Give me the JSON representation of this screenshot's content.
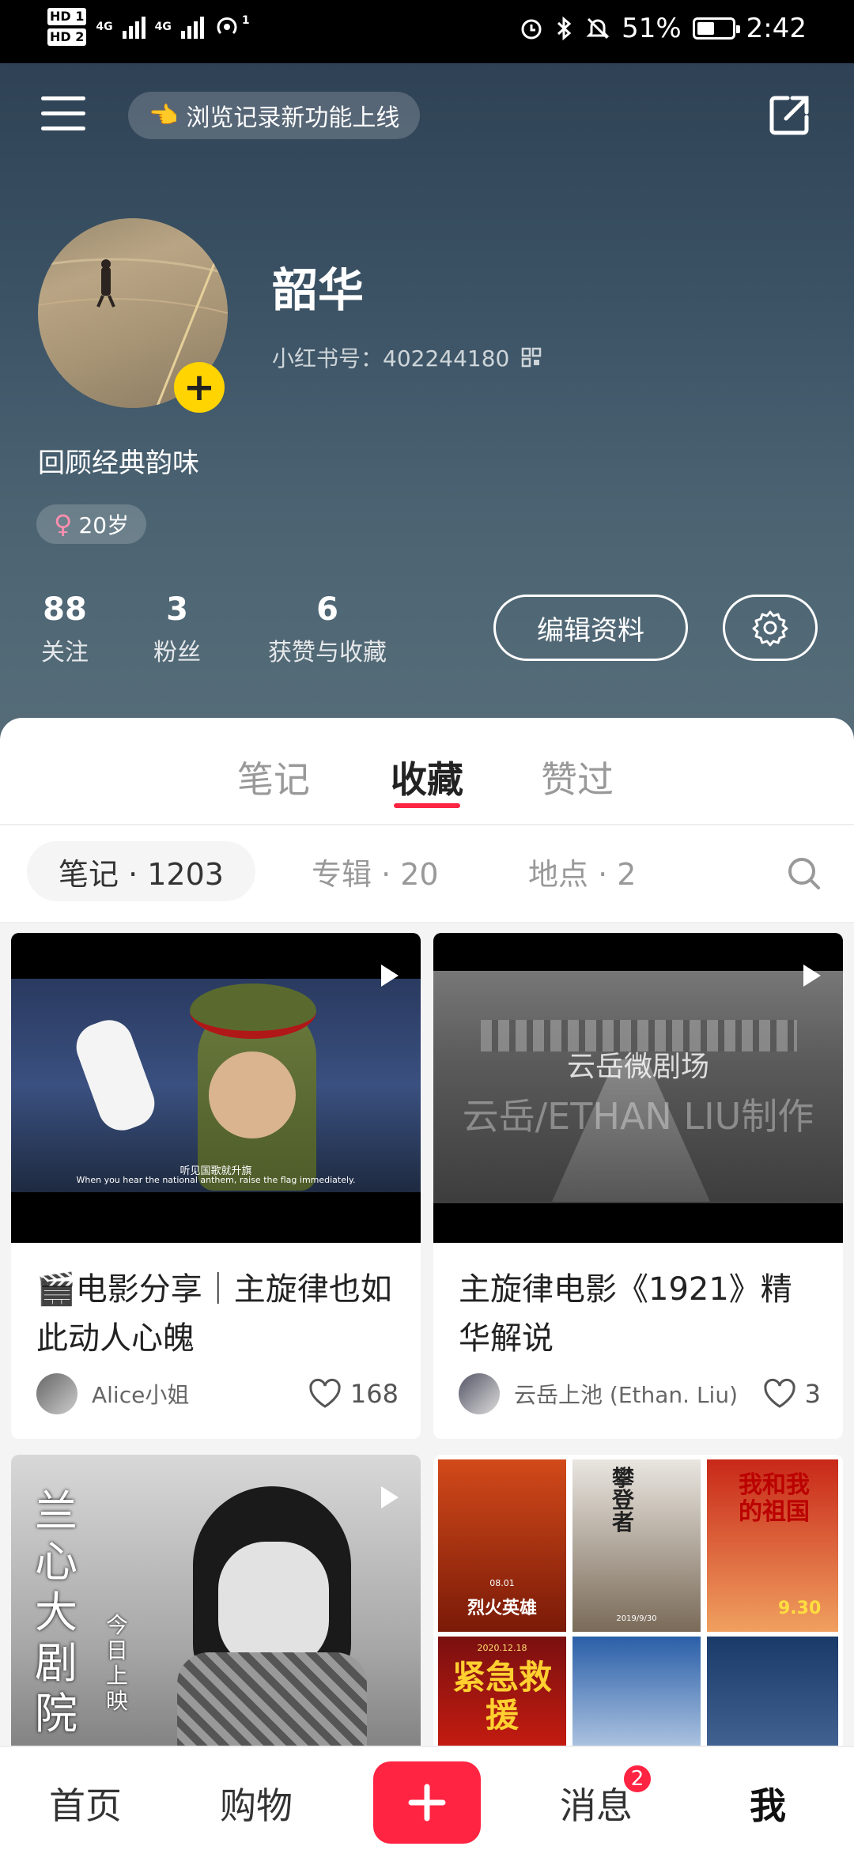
{
  "status_bar": {
    "hd1": "HD 1",
    "hd2": "HD 2",
    "net1": "4G",
    "net2": "4G",
    "hotspot_count": "1",
    "battery": "51%",
    "battery_level": 0.51,
    "time": "2:42",
    "icons": [
      "alarm-icon",
      "bluetooth-icon",
      "mute-icon",
      "battery-icon"
    ]
  },
  "header": {
    "announcement": "浏览记录新功能上线",
    "announcement_icon": "pointing-hand-icon",
    "username": "韶华",
    "id_label": "小红书号：402244180",
    "bio": "回顾经典韵味",
    "tag": "20岁",
    "gender_symbol": "♀",
    "stats": [
      {
        "value": "88",
        "label": "关注"
      },
      {
        "value": "3",
        "label": "粉丝"
      },
      {
        "value": "6",
        "label": "获赞与收藏"
      }
    ],
    "edit_button": "编辑资料"
  },
  "tabs": [
    {
      "label": "笔记",
      "active": false
    },
    {
      "label": "收藏",
      "active": true
    },
    {
      "label": "赞过",
      "active": false
    }
  ],
  "subtabs": [
    {
      "label": "笔记 · 1203",
      "active": true
    },
    {
      "label": "专辑 · 20",
      "active": false
    },
    {
      "label": "地点 · 2",
      "active": false
    }
  ],
  "cards": [
    {
      "caption": "听见国歌就升旗",
      "caption_en": "When you hear the national anthem, raise the flag immediately.",
      "title": "🎬电影分享｜主旋律也如此动人心魄",
      "author": "Alice小姐",
      "likes": "168"
    },
    {
      "watermark1": "云岳微剧场",
      "watermark2": "云岳/ETHAN LIU制作",
      "title": "主旋律电影《1921》精华解说",
      "author": "云岳上池 (Ethan. Liu)",
      "likes": "3"
    },
    {
      "poster_text1": "兰心大剧院",
      "poster_text2": "今日上映"
    },
    {
      "posters": [
        "烈火英雄",
        "攀登者",
        "我和我的祖国",
        "紧急救援",
        "",
        ""
      ],
      "poster_dates": [
        "08.01",
        "2019/9/30",
        "9.30",
        "2020.12.18"
      ]
    }
  ],
  "bottom_nav": {
    "home": "首页",
    "shop": "购物",
    "messages": "消息",
    "messages_badge": "2",
    "me": "我"
  }
}
